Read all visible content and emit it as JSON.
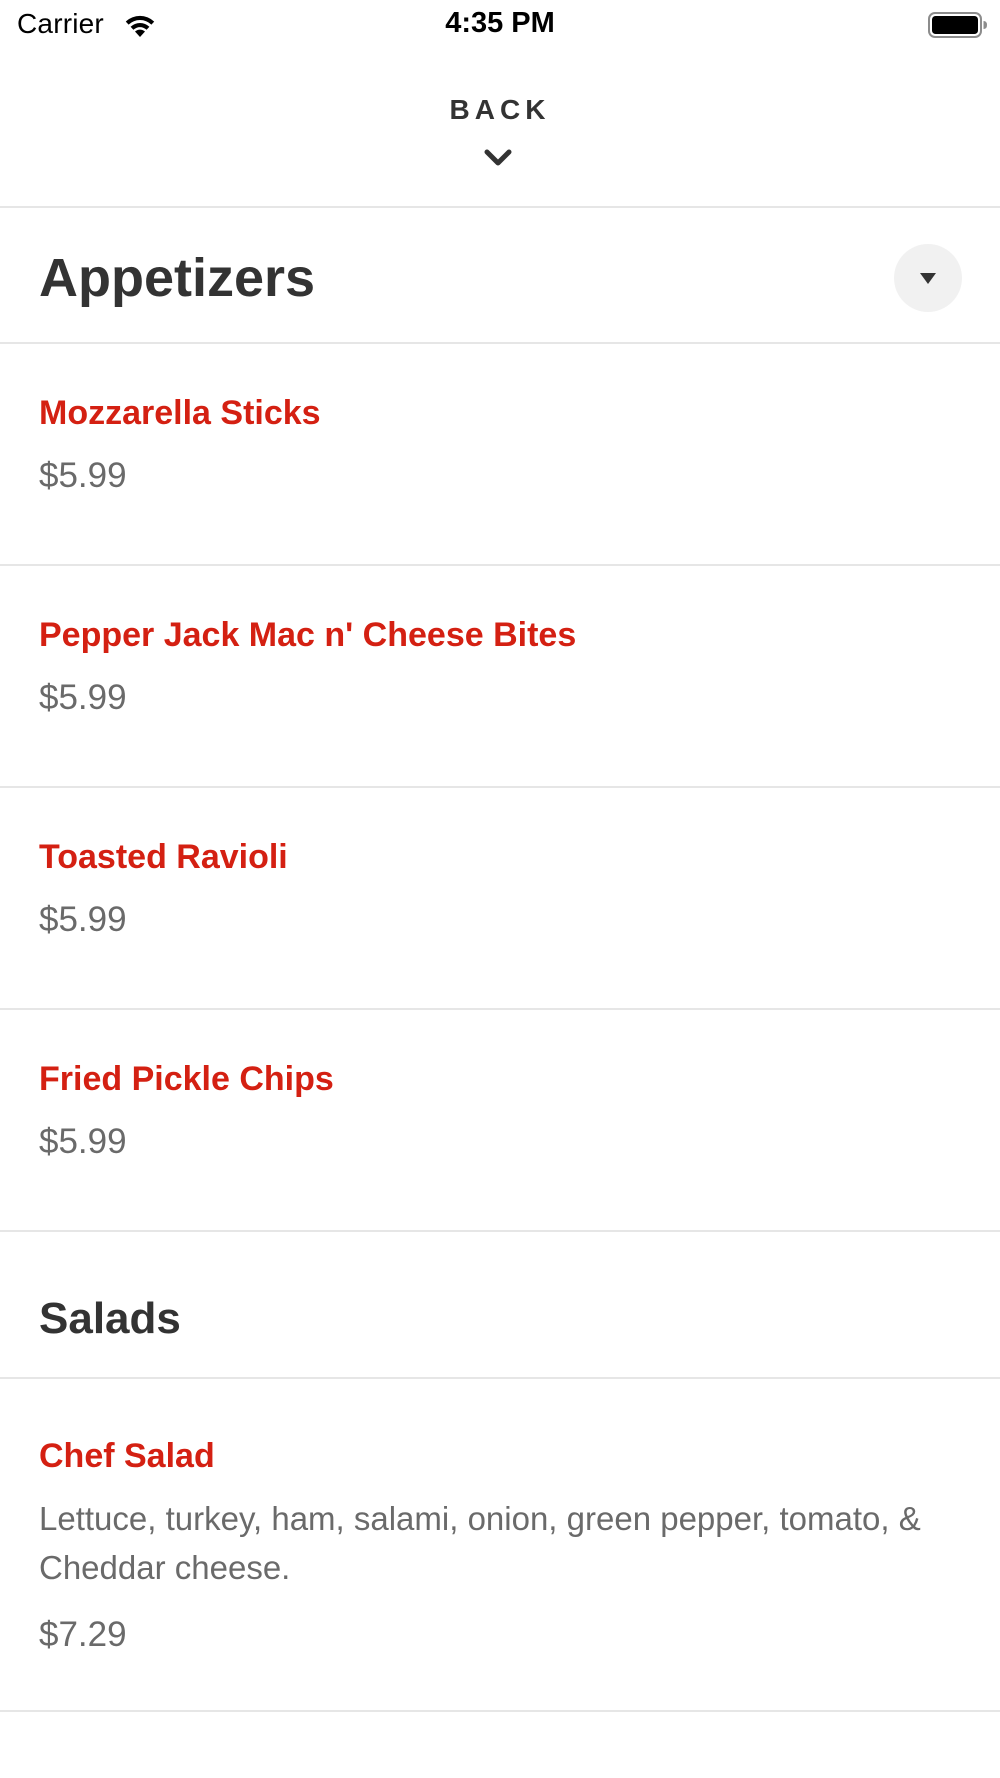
{
  "status_bar": {
    "carrier": "Carrier",
    "time": "4:35 PM",
    "icons": [
      "wifi-icon",
      "battery-icon"
    ]
  },
  "header": {
    "back_label": "BACK",
    "back_icon": "chevron-down-icon"
  },
  "categories": [
    {
      "title": "Appetizers",
      "dropdown_icon": "triangle-down-icon",
      "items": [
        {
          "name": "Mozzarella Sticks",
          "price": "$5.99"
        },
        {
          "name": "Pepper Jack Mac n' Cheese Bites",
          "price": "$5.99"
        },
        {
          "name": "Toasted Ravioli",
          "price": "$5.99"
        },
        {
          "name": "Fried Pickle Chips",
          "price": "$5.99"
        }
      ]
    },
    {
      "title": "Salads",
      "items": [
        {
          "name": "Chef Salad",
          "description": "Lettuce, turkey, ham, salami, onion, green pepper, tomato, & Cheddar cheese.",
          "price": "$7.29"
        }
      ]
    }
  ],
  "colors": {
    "item_name": "#d42012",
    "heading": "#333333",
    "secondary_text": "#6a6a6a",
    "divider": "#e6e6e6",
    "dropdown_bg": "#f1f1f1"
  }
}
